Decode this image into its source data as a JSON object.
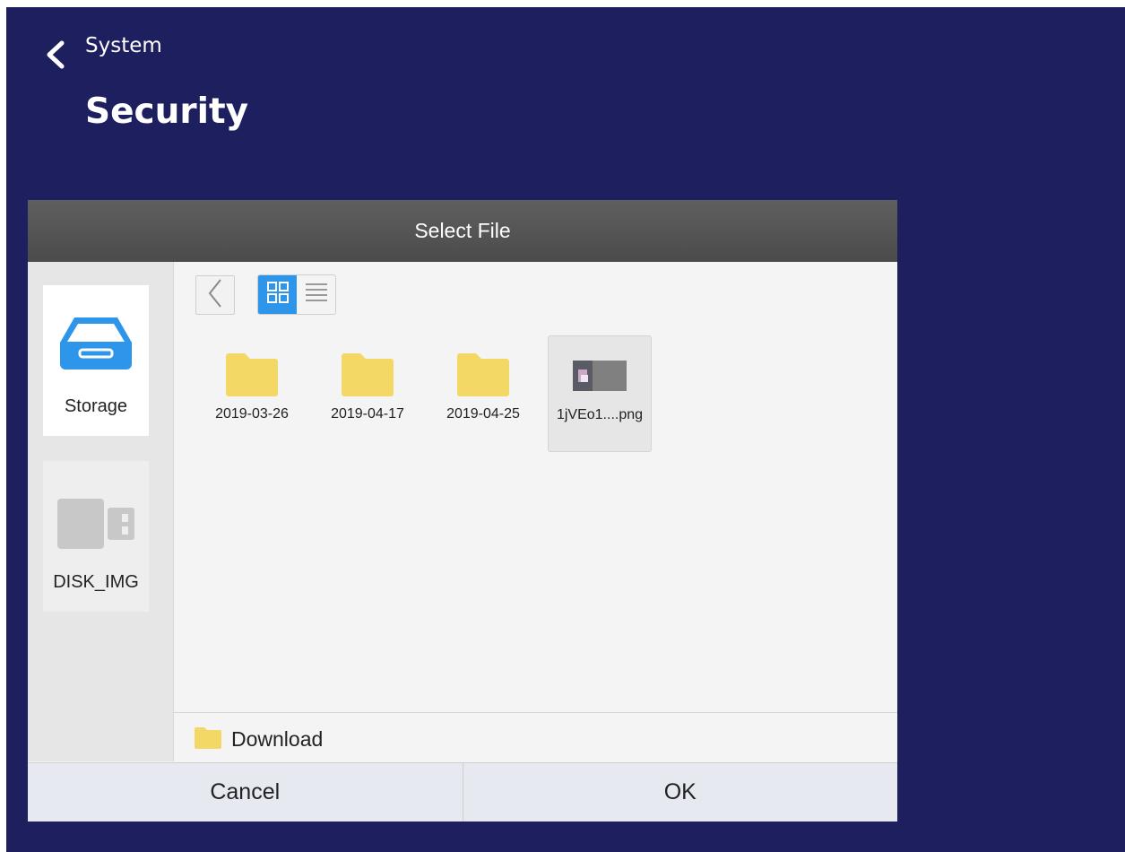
{
  "header": {
    "back_label": "System",
    "title": "Security"
  },
  "dialog": {
    "title": "Select File",
    "sources": [
      {
        "label": "Storage",
        "icon": "storage-tray-icon",
        "active": true
      },
      {
        "label": "DISK_IMG",
        "icon": "usb-drive-icon",
        "active": false
      }
    ],
    "toolbar": {
      "back_icon": "chevron-left-icon",
      "grid_view_icon": "grid-view-icon",
      "list_view_icon": "list-view-icon",
      "active_view": "grid"
    },
    "files": [
      {
        "name": "2019-03-26",
        "type": "folder"
      },
      {
        "name": "2019-04-17",
        "type": "folder"
      },
      {
        "name": "2019-04-25",
        "type": "folder"
      },
      {
        "name": "1jVEo1....png",
        "type": "image",
        "selected": true
      }
    ],
    "current_path": "Download",
    "cancel_label": "Cancel",
    "ok_label": "OK"
  },
  "colors": {
    "background": "#1e1f5f",
    "accent": "#2e96ea",
    "folder": "#f3d865",
    "header_bar": "#545454"
  }
}
